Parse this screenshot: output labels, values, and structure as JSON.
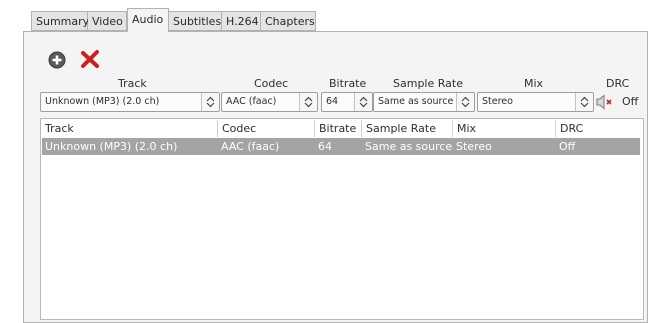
{
  "tabs": [
    {
      "label": "Summary"
    },
    {
      "label": "Video"
    },
    {
      "label": "Audio"
    },
    {
      "label": "Subtitles"
    },
    {
      "label": "H.264"
    },
    {
      "label": "Chapters"
    }
  ],
  "toolbar": {
    "add_icon": "plus-circle-icon",
    "remove_icon": "red-x-icon"
  },
  "editor": {
    "headers": {
      "track": "Track",
      "codec": "Codec",
      "bitrate": "Bitrate",
      "sample_rate": "Sample Rate",
      "mix": "Mix",
      "drc": "DRC"
    },
    "track_value": "Unknown (MP3) (2.0 ch)",
    "codec_value": "AAC (faac)",
    "bitrate_value": "64",
    "sample_rate_value": "Same as source",
    "mix_value": "Stereo",
    "drc_value": "Off",
    "drc_icon": "speaker-muted-icon"
  },
  "list": {
    "columns": [
      "Track",
      "Codec",
      "Bitrate",
      "Sample Rate",
      "Mix",
      "DRC"
    ],
    "rows": [
      {
        "track": "Unknown (MP3) (2.0 ch)",
        "codec": "AAC (faac)",
        "bitrate": "64",
        "sample_rate": "Same as source",
        "mix": "Stereo",
        "drc": "Off"
      }
    ]
  },
  "colors": {
    "selected_row": "#a4a4a4",
    "remove_red": "#cc2020",
    "add_gray": "#5a5a5a"
  }
}
